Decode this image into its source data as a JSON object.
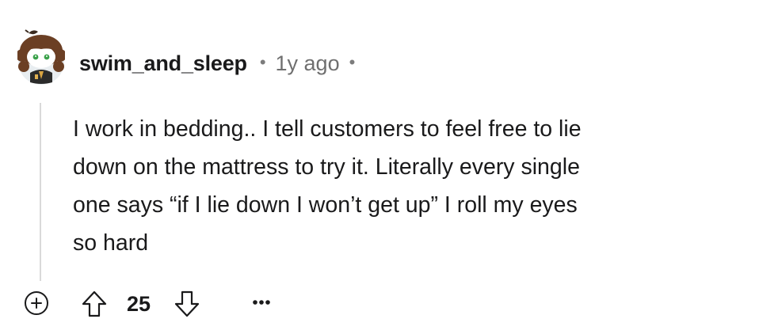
{
  "comment": {
    "avatar_icon": "user-avatar-snoo-icon",
    "username": "swim_and_sleep",
    "separator": "•",
    "timestamp": "1y ago",
    "body_lines": [
      "I work in bedding.. I tell customers to feel free to lie",
      "down on the mattress to try it. Literally every single",
      "one says “if I lie down I won’t get up” I roll my eyes",
      "so hard"
    ],
    "actions": {
      "expand_icon": "plus-circle-icon",
      "upvote_icon": "arrow-up-icon",
      "score": "25",
      "downvote_icon": "arrow-down-icon",
      "more_icon": "more-horizontal-icon"
    }
  },
  "colors": {
    "text": "#1a1a1b",
    "muted": "#6f6f6f",
    "thread_line": "#d9d9d9",
    "background": "#ffffff"
  }
}
